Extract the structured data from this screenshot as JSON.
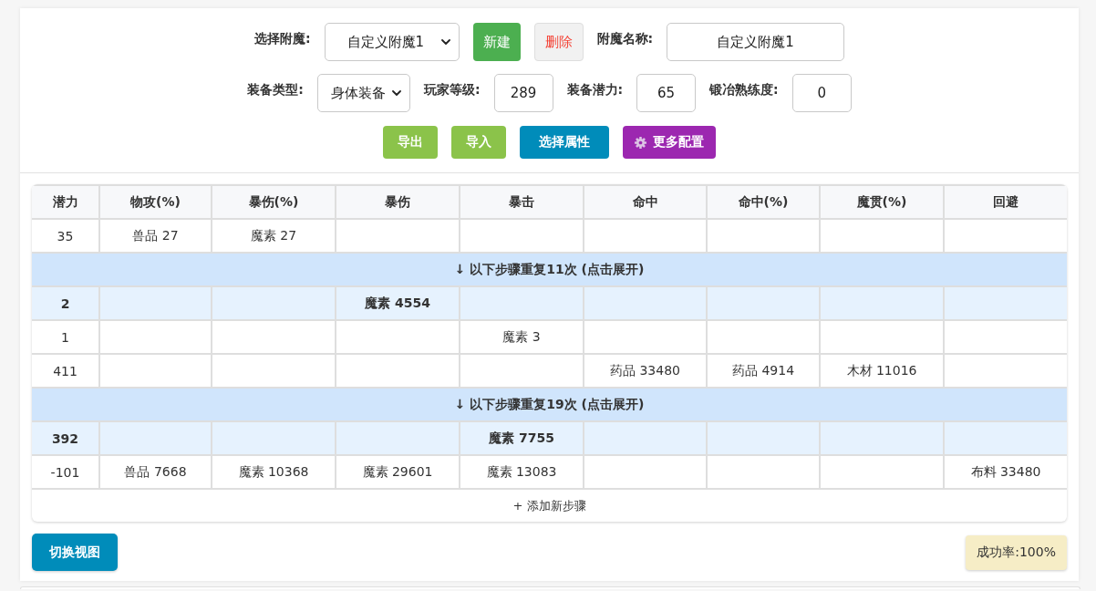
{
  "enchant_selector": {
    "label": "选择附魔:",
    "value": "自定义附魔1"
  },
  "new_button": "新建",
  "delete_button": "删除",
  "enchant_name": {
    "label": "附魔名称:",
    "value": "自定义附魔1"
  },
  "equipment_fields": [
    {
      "kind": "select",
      "label": "装备类型:",
      "value": "身体装备"
    },
    {
      "kind": "input",
      "label": "玩家等级:",
      "value": "289"
    },
    {
      "kind": "input",
      "label": "装备潜力:",
      "value": "65"
    },
    {
      "kind": "input",
      "label": "锻冶熟练度:",
      "value": "0"
    }
  ],
  "actions": [
    {
      "label": "导出",
      "color": "#8bc34a",
      "icon": false
    },
    {
      "label": "导入",
      "color": "#8bc34a",
      "icon": false
    },
    {
      "label": "选择属性",
      "color": "#008cba",
      "icon": false
    },
    {
      "label": "更多配置",
      "color": "#9c27b0",
      "icon": true
    }
  ],
  "steps_table": {
    "columns": [
      "潜力",
      "物攻(%)",
      "暴伤(%)",
      "暴伤",
      "暴击",
      "命中",
      "命中(%)",
      "魔贯(%)",
      "回避"
    ],
    "rows": [
      {
        "kind": "step",
        "cells": [
          "35",
          "兽品 27",
          "魔素 27",
          null,
          null,
          null,
          null,
          null,
          null
        ]
      },
      {
        "kind": "repeat",
        "text": "↓ 以下步骤重复11次 (点击展开)"
      },
      {
        "kind": "summary",
        "cells": [
          "2",
          null,
          null,
          "魔素 4554",
          null,
          null,
          null,
          null,
          null
        ]
      },
      {
        "kind": "step",
        "cells": [
          "1",
          null,
          null,
          null,
          "魔素 3",
          null,
          null,
          null,
          null
        ]
      },
      {
        "kind": "step",
        "cells": [
          "411",
          null,
          null,
          null,
          null,
          "药品 33480",
          "药品 4914",
          "木材 11016",
          null
        ]
      },
      {
        "kind": "repeat",
        "text": "↓ 以下步骤重复19次 (点击展开)"
      },
      {
        "kind": "summary",
        "cells": [
          "392",
          null,
          null,
          null,
          "魔素 7755",
          null,
          null,
          null,
          null
        ]
      },
      {
        "kind": "step",
        "cells": [
          "-101",
          "兽品 7668",
          "魔素 10368",
          "魔素 29601",
          "魔素 13083",
          null,
          null,
          null,
          "布料 33480"
        ]
      }
    ],
    "add_step": "+ 添加新步骤"
  },
  "toggle_view_button": "切换视图",
  "success_rate": "成功率:100%"
}
